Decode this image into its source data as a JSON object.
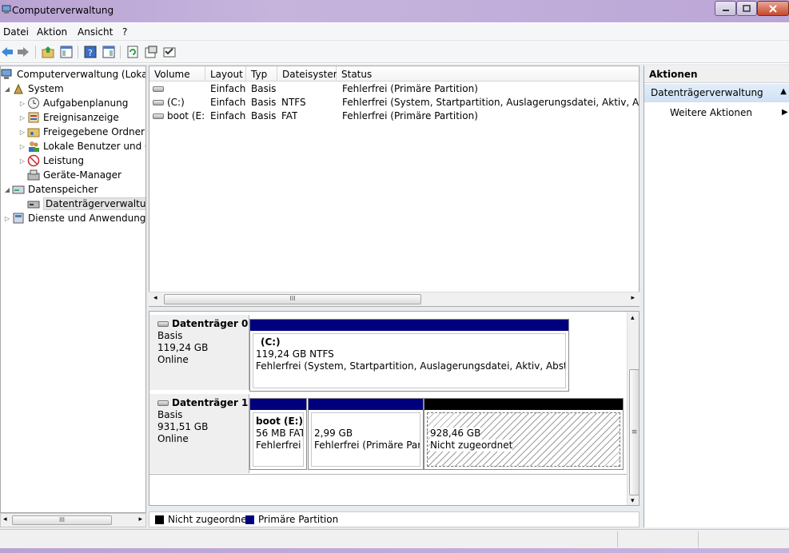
{
  "window": {
    "title": "Computerverwaltung"
  },
  "menu": [
    "Datei",
    "Aktion",
    "Ansicht",
    "?"
  ],
  "tree": {
    "root": "Computerverwaltung (Lokal)",
    "system": "System",
    "aufgabenplanung": "Aufgabenplanung",
    "ereignisanzeige": "Ereignisanzeige",
    "freigegebene": "Freigegebene Ordner",
    "benutzer": "Lokale Benutzer und Gruppen",
    "leistung": "Leistung",
    "geraete": "Geräte-Manager",
    "datenspeicher": "Datenspeicher",
    "datentraeger": "Datenträgerverwaltung",
    "dienste": "Dienste und Anwendungen"
  },
  "volumes": {
    "headers": [
      "Volume",
      "Layout",
      "Typ",
      "Dateisystem",
      "Status"
    ],
    "rows": [
      {
        "volume": "",
        "layout": "Einfach",
        "typ": "Basis",
        "fs": "",
        "status": "Fehlerfrei (Primäre Partition)"
      },
      {
        "volume": "(C:)",
        "layout": "Einfach",
        "typ": "Basis",
        "fs": "NTFS",
        "status": "Fehlerfrei (System, Startpartition, Auslagerungsdatei, Aktiv, Absturzabbild, Primäre Partition)"
      },
      {
        "volume": "boot (E:)",
        "layout": "Einfach",
        "typ": "Basis",
        "fs": "FAT",
        "status": "Fehlerfrei (Primäre Partition)"
      }
    ]
  },
  "scroll_grip": "III",
  "disks": [
    {
      "name": "Datenträger 0",
      "type": "Basis",
      "size": "119,24 GB",
      "state": "Online",
      "partitions": [
        {
          "title": "(C:)",
          "line1": "119,24 GB NTFS",
          "line2": "Fehlerfrei (System, Startpartition, Auslagerungsdatei, Aktiv, Absturzabbild, Primäre Partition)"
        }
      ]
    },
    {
      "name": "Datenträger 1",
      "type": "Basis",
      "size": "931,51 GB",
      "state": "Online",
      "partitions": [
        {
          "title": "boot  (E:)",
          "line1": "56 MB FAT",
          "line2": "Fehlerfrei (Primäre Partition)"
        },
        {
          "title": "",
          "line1": "2,99 GB",
          "line2": "Fehlerfrei (Primäre Partition)"
        },
        {
          "title": "",
          "line1": "928,46 GB",
          "line2": "Nicht zugeordnet"
        }
      ]
    }
  ],
  "legend": [
    {
      "label": "Nicht zugeordnet",
      "color": "#000000"
    },
    {
      "label": "Primäre Partition",
      "color": "#00007f"
    }
  ],
  "actions": {
    "header": "Aktionen",
    "section": "Datenträgerverwaltung",
    "item": "Weitere Aktionen"
  },
  "colors": {
    "primary_partition": "#00007f",
    "unallocated": "#000000",
    "titlebar": "#c6b4dd"
  }
}
